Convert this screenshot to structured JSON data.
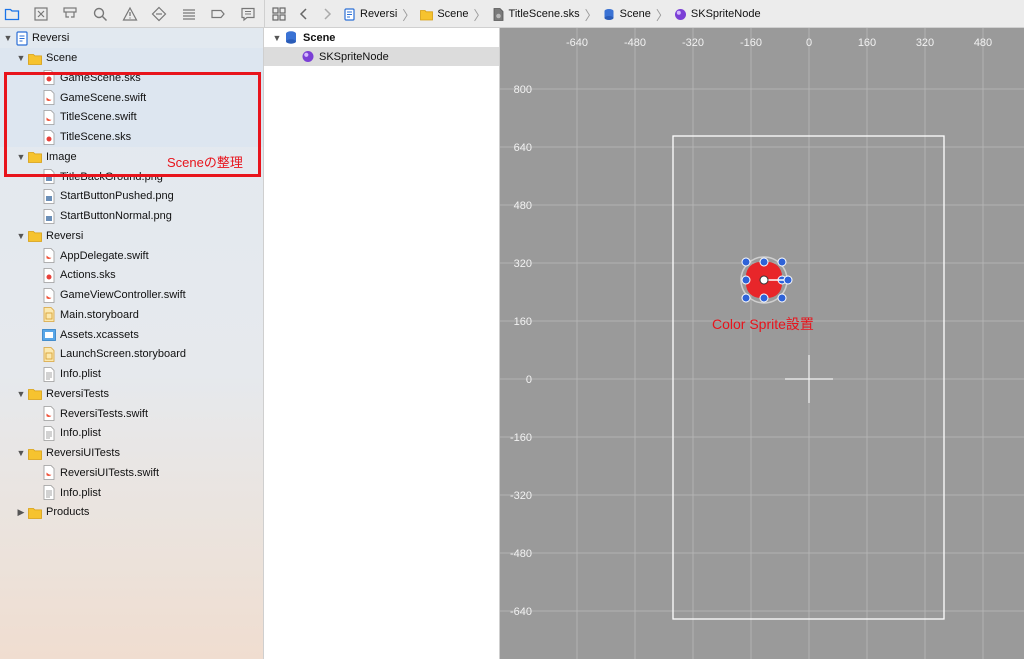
{
  "navigator_toolbar": {
    "icons": [
      "folder-icon",
      "source-control-icon",
      "hierarchy-icon",
      "search-icon",
      "warning-icon",
      "test-diamond-icon",
      "debug-list-icon",
      "breakpoint-icon",
      "report-icon"
    ]
  },
  "jump_bar": {
    "crumbs": [
      {
        "label": "Reversi",
        "icon": "project-icon"
      },
      {
        "label": "Scene",
        "icon": "folder-icon"
      },
      {
        "label": "TitleScene.sks",
        "icon": "sks-file-icon"
      },
      {
        "label": "Scene",
        "icon": "scene-icon"
      },
      {
        "label": "SKSpriteNode",
        "icon": "sprite-node-icon"
      }
    ]
  },
  "navigator": {
    "project": "Reversi",
    "items": [
      {
        "label": "Scene",
        "type": "folder"
      },
      {
        "label": "GameScene.sks",
        "type": "sks"
      },
      {
        "label": "GameScene.swift",
        "type": "swift"
      },
      {
        "label": "TitleScene.swift",
        "type": "swift"
      },
      {
        "label": "TitleScene.sks",
        "type": "sks"
      },
      {
        "label": "Image",
        "type": "folder"
      },
      {
        "label": "TitleBackGround.png",
        "type": "png"
      },
      {
        "label": "StartButtonPushed.png",
        "type": "png"
      },
      {
        "label": "StartButtonNormal.png",
        "type": "png"
      },
      {
        "label": "Reversi",
        "type": "folder"
      },
      {
        "label": "AppDelegate.swift",
        "type": "swift"
      },
      {
        "label": "Actions.sks",
        "type": "sks"
      },
      {
        "label": "GameViewController.swift",
        "type": "swift"
      },
      {
        "label": "Main.storyboard",
        "type": "storyboard"
      },
      {
        "label": "Assets.xcassets",
        "type": "xcassets"
      },
      {
        "label": "LaunchScreen.storyboard",
        "type": "storyboard"
      },
      {
        "label": "Info.plist",
        "type": "plist"
      },
      {
        "label": "ReversiTests",
        "type": "folder"
      },
      {
        "label": "ReversiTests.swift",
        "type": "swift"
      },
      {
        "label": "Info.plist",
        "type": "plist"
      },
      {
        "label": "ReversiUITests",
        "type": "folder"
      },
      {
        "label": "ReversiUITests.swift",
        "type": "swift"
      },
      {
        "label": "Info.plist",
        "type": "plist"
      },
      {
        "label": "Products",
        "type": "folder"
      }
    ],
    "selected": "TitleScene.sks",
    "annotation": "Sceneの整理"
  },
  "outline": {
    "root": "Scene",
    "child": "SKSpriteNode"
  },
  "canvas": {
    "x_ticks": [
      "-640",
      "-480",
      "-320",
      "-160",
      "0",
      "160",
      "320",
      "480"
    ],
    "y_ticks": [
      "800",
      "640",
      "480",
      "320",
      "160",
      "0",
      "-160",
      "-320",
      "-480",
      "-640"
    ],
    "annotation": "Color Sprite設置",
    "sprite_color": "#e8262a",
    "handle_color": "#2f63d8",
    "background_color": "#9a9a9a"
  }
}
